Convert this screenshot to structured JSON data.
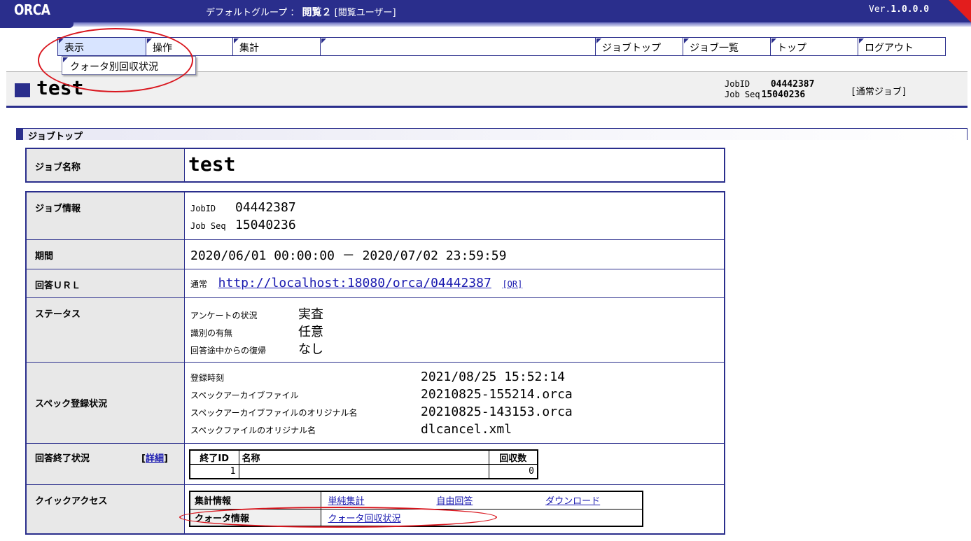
{
  "app": {
    "logo": "ORCA",
    "group_label": "デフォルトグループ ：",
    "user_name": "閲覧２",
    "user_role": "[閲覧ユーザー]",
    "version_prefix": "Ver.",
    "version": "1.0.0.0"
  },
  "menu": {
    "items": [
      "表示",
      "操作",
      "集計",
      "ジョブトップ",
      "ジョブ一覧",
      "トップ",
      "ログアウト"
    ],
    "dropdown_item": "クォータ別回収状況"
  },
  "header": {
    "title": "test",
    "jobid_label": "JobID",
    "jobid": "04442387",
    "jobseq_label": "Job Seq",
    "jobseq": "15040236",
    "job_type": "[通常ジョブ]"
  },
  "section_title": "ジョブトップ",
  "name_row": {
    "label": "ジョブ名称",
    "value": "test"
  },
  "info": {
    "job_info": {
      "label": "ジョブ情報",
      "jobid_label": "JobID",
      "jobid": "04442387",
      "jobseq_label": "Job Seq",
      "jobseq": "15040236"
    },
    "period": {
      "label": "期間",
      "value": "2020/06/01 00:00:00 － 2020/07/02 23:59:59"
    },
    "url": {
      "label": "回答ＵＲＬ",
      "prefix": "通常",
      "link": "http://localhost:18080/orca/04442387",
      "qr": "[QR]"
    },
    "status": {
      "label": "ステータス",
      "items": [
        {
          "k": "アンケートの状況",
          "v": "実査"
        },
        {
          "k": "識別の有無",
          "v": "任意"
        },
        {
          "k": "回答途中からの復帰",
          "v": "なし"
        }
      ]
    },
    "spec": {
      "label": "スペック登録状況",
      "items": [
        {
          "k": "登録時刻",
          "v": "2021/08/25 15:52:14"
        },
        {
          "k": "スペックアーカイブファイル",
          "v": "20210825-155214.orca"
        },
        {
          "k": "スペックアーカイブファイルのオリジナル名",
          "v": "20210825-143153.orca"
        },
        {
          "k": "スペックファイルのオリジナル名",
          "v": "dlcancel.xml"
        }
      ]
    },
    "completion": {
      "label": "回答終了状況",
      "detail_open": "[",
      "detail": "詳細",
      "detail_close": "]",
      "headers": [
        "終了ID",
        "名称",
        "回収数"
      ],
      "rows": [
        {
          "id": "1",
          "name": "",
          "count": "0"
        }
      ]
    },
    "quick": {
      "label": "クイックアクセス",
      "agg_label": "集計情報",
      "agg_links": [
        "単純集計",
        "自由回答",
        "ダウンロード"
      ],
      "quota_label": "クォータ情報",
      "quota_link": "クォータ回収状況"
    }
  },
  "colors": {
    "brand": "#2a2e8c",
    "annotation": "#d9161e",
    "corner": "#e31d1d"
  }
}
